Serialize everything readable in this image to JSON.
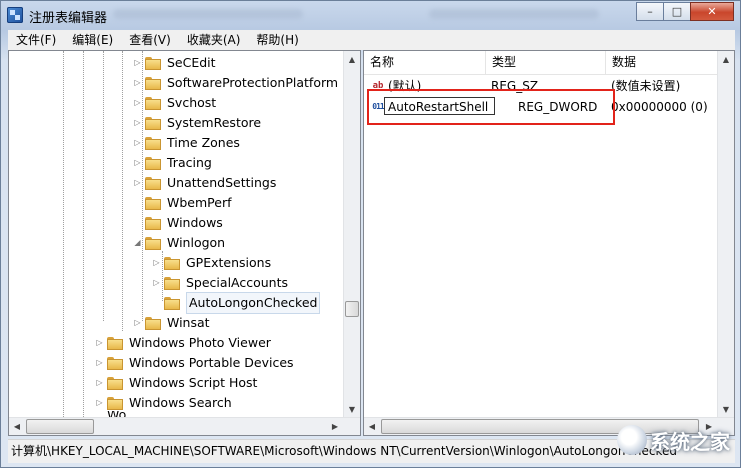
{
  "window": {
    "title": "注册表编辑器",
    "controls": {
      "minimize": "–",
      "maximize": "□",
      "close": "✕"
    }
  },
  "menu": [
    {
      "label": "文件(F)"
    },
    {
      "label": "编辑(E)"
    },
    {
      "label": "查看(V)"
    },
    {
      "label": "收藏夹(A)"
    },
    {
      "label": "帮助(H)"
    }
  ],
  "tree": {
    "items": [
      {
        "label": "SeCEdit",
        "expander": "▷"
      },
      {
        "label": "SoftwareProtectionPlatform",
        "expander": "▷"
      },
      {
        "label": "Svchost",
        "expander": "▷"
      },
      {
        "label": "SystemRestore",
        "expander": "▷"
      },
      {
        "label": "Time Zones",
        "expander": "▷"
      },
      {
        "label": "Tracing",
        "expander": "▷"
      },
      {
        "label": "UnattendSettings",
        "expander": "▷"
      },
      {
        "label": "WbemPerf",
        "expander": ""
      },
      {
        "label": "Windows",
        "expander": ""
      },
      {
        "label": "Winlogon",
        "expander": "◢"
      },
      {
        "label": "GPExtensions",
        "expander": "▷"
      },
      {
        "label": "SpecialAccounts",
        "expander": "▷"
      },
      {
        "label": "AutoLongonChecked",
        "expander": "",
        "selected": true
      },
      {
        "label": "Winsat",
        "expander": "▷"
      },
      {
        "label": "Windows Photo Viewer",
        "expander": "▷"
      },
      {
        "label": "Windows Portable Devices",
        "expander": "▷"
      },
      {
        "label": "Windows Script Host",
        "expander": "▷"
      },
      {
        "label": "Windows Search",
        "expander": "▷"
      },
      {
        "label": "Wo...",
        "expander": ""
      }
    ]
  },
  "list": {
    "columns": [
      {
        "label": "名称"
      },
      {
        "label": "类型"
      },
      {
        "label": "数据"
      }
    ],
    "rows": [
      {
        "name": "(默认)",
        "type": "REG_SZ",
        "data": "(数值未设置)",
        "icon": "ab"
      },
      {
        "name": "AutoRestartShell",
        "type": "REG_DWORD",
        "data": "0x00000000 (0)",
        "icon": "011"
      }
    ]
  },
  "status": {
    "path": "计算机\\HKEY_LOCAL_MACHINE\\SOFTWARE\\Microsoft\\Windows NT\\CurrentVersion\\Winlogon\\AutoLongonChecked"
  },
  "watermark": {
    "text": "系统之家"
  },
  "colors": {
    "highlight_box": "#e2231a",
    "folder": "#e8b84a"
  }
}
